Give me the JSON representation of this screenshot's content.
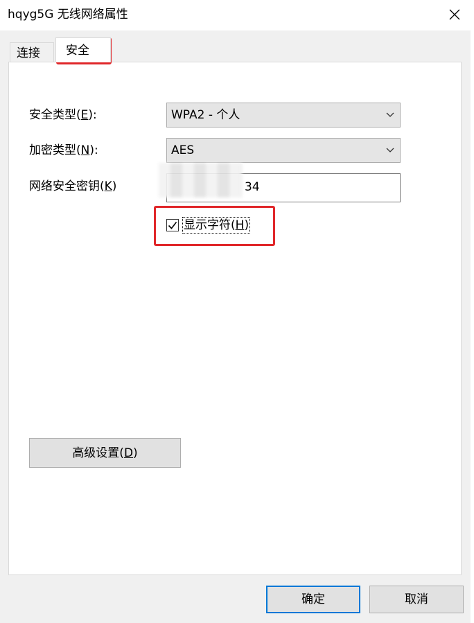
{
  "window": {
    "title": "hqyg5G 无线网络属性"
  },
  "tabs": [
    {
      "label": "连接",
      "active": false
    },
    {
      "label": "安全",
      "active": true
    }
  ],
  "form": {
    "security_type": {
      "label_prefix": "安全类型(",
      "label_key": "E",
      "label_suffix": "):",
      "value": "WPA2 - 个人"
    },
    "encryption_type": {
      "label_prefix": "加密类型(",
      "label_key": "N",
      "label_suffix": "):",
      "value": "AES"
    },
    "network_key": {
      "label_prefix": "网络安全密钥(",
      "label_key": "K",
      "label_suffix": ")",
      "value": "34"
    },
    "show_chars": {
      "label_prefix": "显示字符(",
      "label_key": "H",
      "label_suffix": ")",
      "checked": true
    }
  },
  "buttons": {
    "advanced_prefix": "高级设置(",
    "advanced_key": "D",
    "advanced_suffix": ")",
    "ok": "确定",
    "cancel": "取消"
  },
  "icons": {
    "close": "close-icon",
    "dropdown": "chevron-down-icon",
    "check": "checkmark-icon"
  },
  "colors": {
    "highlight": "#e0272a",
    "focus": "#0078d7"
  }
}
